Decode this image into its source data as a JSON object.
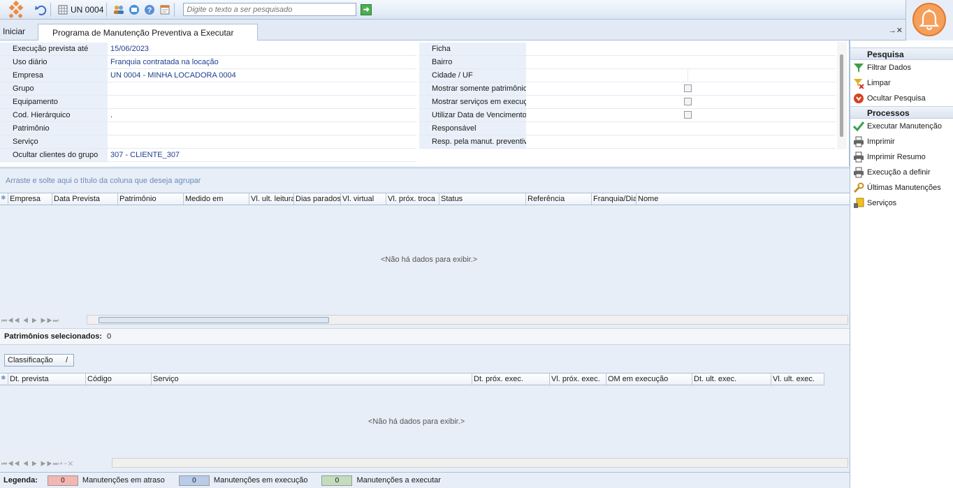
{
  "toolbar": {
    "unit_label": "UN 0004",
    "search_placeholder": "Digite o texto a ser pesquisado"
  },
  "tabs": {
    "home": "Iniciar",
    "active": "Programa de Manutenção Preventiva a Executar",
    "close_glyphs": "→✕"
  },
  "filters": {
    "left": [
      {
        "label": "Execução prevista até",
        "value": "15/06/2023"
      },
      {
        "label": "Uso diário",
        "value": "Franquia contratada na locação"
      },
      {
        "label": "Empresa",
        "value": "UN 0004 - MINHA LOCADORA 0004"
      },
      {
        "label": "Grupo",
        "value": ""
      },
      {
        "label": "Equipamento",
        "value": ""
      },
      {
        "label": "Cod. Hierárquico",
        "value": "."
      },
      {
        "label": "Patrimônio",
        "value": ""
      },
      {
        "label": "Serviço",
        "value": ""
      },
      {
        "label": "Ocultar clientes do grupo",
        "value": "307 - CLIENTE_307"
      }
    ],
    "right": [
      {
        "label": "Ficha"
      },
      {
        "label": "Bairro"
      },
      {
        "label": "Cidade / UF"
      },
      {
        "label": "Mostrar somente patrimônios lo"
      },
      {
        "label": "Mostrar serviços em execução"
      },
      {
        "label": "Utilizar Data de Vencimento da"
      },
      {
        "label": "Responsável"
      },
      {
        "label": "Resp. pela manut. preventiva"
      }
    ]
  },
  "group_hint": "Arraste e solte aqui o título da coluna que deseja agrupar",
  "grid1": {
    "columns": [
      "Empresa",
      "Data Prevista",
      "Patrimônio",
      "Medido em",
      "Vl. ult. leitura",
      "Dias parados",
      "Vl. virtual",
      "Vl. próx. troca",
      "Status",
      "Referência",
      "Franquia/Dia",
      "Nome"
    ],
    "empty": "<Não há dados para exibir.>",
    "nav": "⏮◀◀ ◀ ▶ ▶▶⏭"
  },
  "summary": {
    "label": "Patrimônios selecionados:",
    "value": "0"
  },
  "sort_button": "Classificação",
  "sort_glyph": "/",
  "grid2": {
    "columns": [
      "Dt. prevista",
      "Código",
      "Serviço",
      "Dt. próx. exec.",
      "Vl. próx. exec.",
      "OM em execução",
      "Dt. ult. exec.",
      "Vl. ult. exec."
    ],
    "empty": "<Não há dados para exibir.>",
    "nav": "⏮◀◀ ◀ ▶ ▶▶⏭+−✕"
  },
  "legend": {
    "title": "Legenda:",
    "items": [
      {
        "count": "0",
        "text": "Manutenções em atraso",
        "color": "#f4b6b0"
      },
      {
        "count": "0",
        "text": "Manutenções em execução",
        "color": "#b8cbe8"
      },
      {
        "count": "0",
        "text": "Manutenções a executar",
        "color": "#c2dcbc"
      }
    ]
  },
  "sidepanel": {
    "pesquisa_title": "Pesquisa",
    "pesquisa": [
      "Filtrar Dados",
      "Limpar",
      "Ocultar Pesquisa"
    ],
    "processos_title": "Processos",
    "processos": [
      "Executar Manutenção",
      "Imprimir",
      "Imprimir Resumo",
      "Execução a definir",
      "Últimas Manutenções",
      "Serviços"
    ]
  }
}
